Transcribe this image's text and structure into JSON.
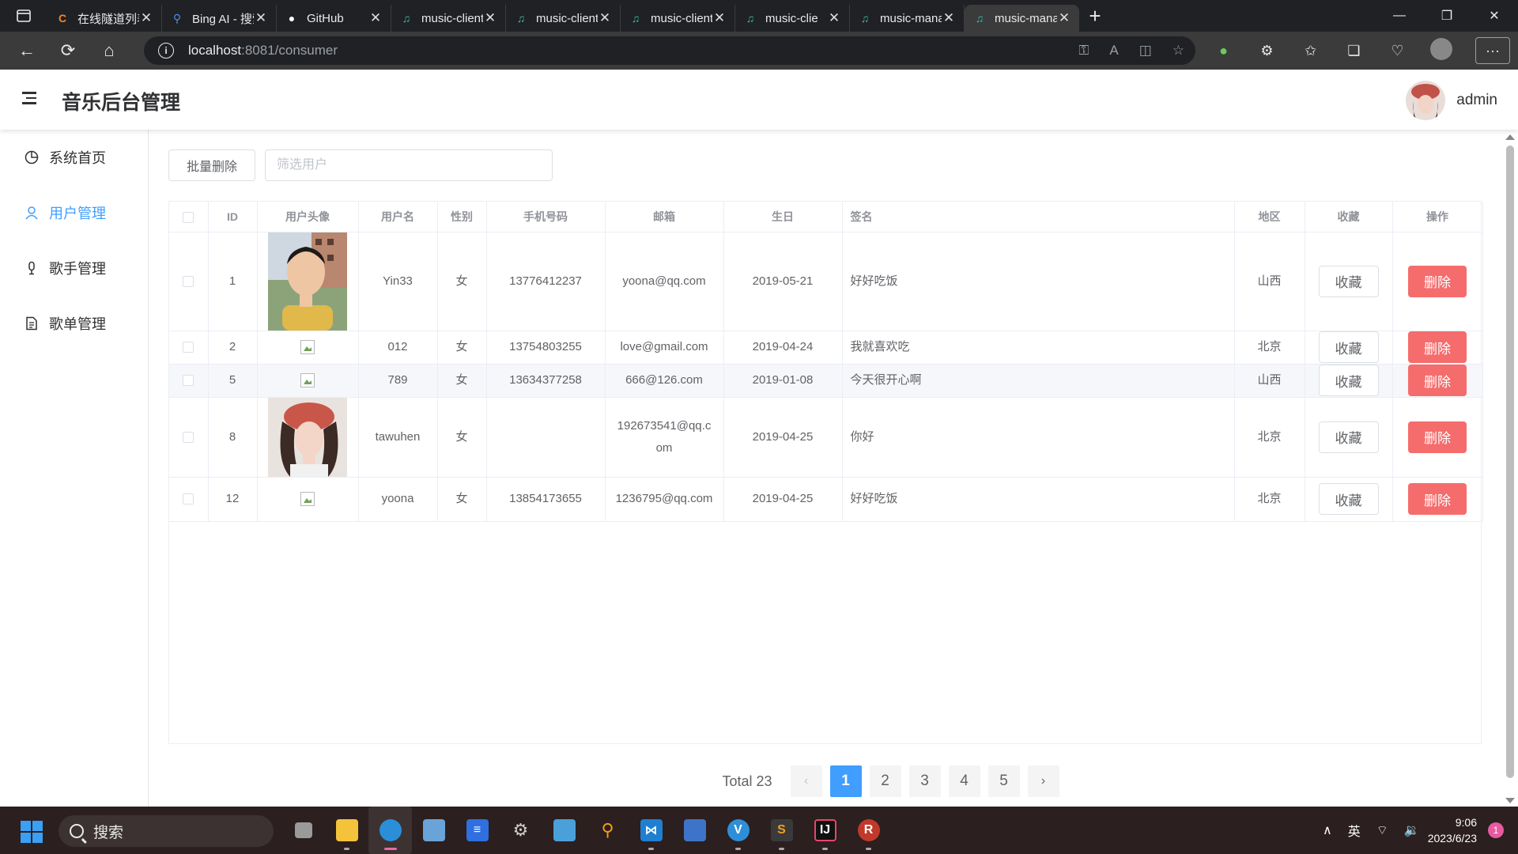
{
  "browser": {
    "tabs": [
      {
        "title": "在线隧道列表",
        "icon": "c-logo-icon",
        "active": false
      },
      {
        "title": "Bing AI - 搜索",
        "icon": "bing-search-icon",
        "active": false
      },
      {
        "title": "GitHub",
        "icon": "github-icon",
        "active": false
      },
      {
        "title": "music-client",
        "icon": "headphones-icon",
        "active": false
      },
      {
        "title": "music-client",
        "icon": "headphones-icon",
        "active": false
      },
      {
        "title": "music-client",
        "icon": "headphones-icon",
        "active": false
      },
      {
        "title": "music-clie",
        "icon": "headphones-icon",
        "active": false
      },
      {
        "title": "music-manage",
        "icon": "headphones-icon",
        "active": false
      },
      {
        "title": "music-manage",
        "icon": "headphones-icon",
        "active": true
      }
    ],
    "url_host": "localhost",
    "url_path": ":8081/consumer"
  },
  "app": {
    "title": "音乐后台管理",
    "username": "admin"
  },
  "sidebar": {
    "items": [
      {
        "label": "系统首页",
        "icon": "pie-chart-icon",
        "active": false
      },
      {
        "label": "用户管理",
        "icon": "user-icon",
        "active": true
      },
      {
        "label": "歌手管理",
        "icon": "microphone-icon",
        "active": false
      },
      {
        "label": "歌单管理",
        "icon": "document-icon",
        "active": false
      }
    ]
  },
  "toolbar": {
    "batch_delete_label": "批量删除",
    "filter_placeholder": "筛选用户"
  },
  "table": {
    "columns": [
      "ID",
      "用户头像",
      "用户名",
      "性别",
      "手机号码",
      "邮箱",
      "生日",
      "签名",
      "地区",
      "收藏",
      "操作"
    ],
    "fav_label": "收藏",
    "delete_label": "删除",
    "rows": [
      {
        "id": "1",
        "avatar": "photo-boy",
        "username": "Yin33",
        "sex": "女",
        "phone": "13776412237",
        "email": "yoona@qq.com",
        "birth": "2019-05-21",
        "intro": "好好吃饭",
        "location": "山西"
      },
      {
        "id": "2",
        "avatar": "broken",
        "username": "012",
        "sex": "女",
        "phone": "13754803255",
        "email": "love@gmail.com",
        "birth": "2019-04-24",
        "intro": "我就喜欢吃",
        "location": "北京"
      },
      {
        "id": "5",
        "avatar": "broken",
        "username": "789",
        "sex": "女",
        "phone": "13634377258",
        "email": "666@126.com",
        "birth": "2019-01-08",
        "intro": "今天很开心啊",
        "location": "山西"
      },
      {
        "id": "8",
        "avatar": "photo-girl",
        "username": "tawuhen",
        "sex": "女",
        "phone": "",
        "email": "192673541@qq.com",
        "birth": "2019-04-25",
        "intro": "你好",
        "location": "北京"
      },
      {
        "id": "12",
        "avatar": "broken",
        "username": "yoona",
        "sex": "女",
        "phone": "13854173655",
        "email": "1236795@qq.com",
        "birth": "2019-04-25",
        "intro": "好好吃饭",
        "location": "北京"
      }
    ]
  },
  "pagination": {
    "total_label": "Total 23",
    "pages": [
      "1",
      "2",
      "3",
      "4",
      "5"
    ],
    "current": "1"
  },
  "taskbar": {
    "search_placeholder": "搜索",
    "ime": "英",
    "time": "9:06",
    "date": "2023/6/23",
    "notification_count": "1"
  },
  "colors": {
    "primary": "#409eff",
    "danger": "#f56c6c",
    "browser_dark": "#202124"
  }
}
